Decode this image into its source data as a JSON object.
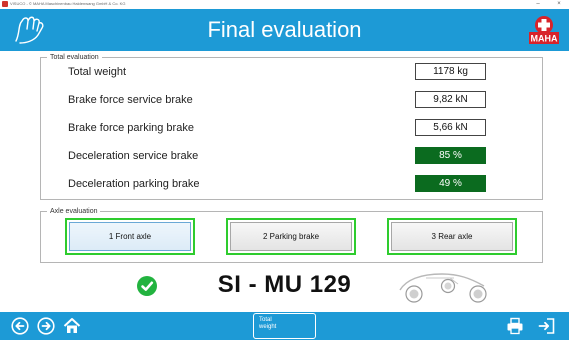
{
  "titlebar": {
    "title": "VISUCO - © MAHA Maschinenbau Haldenwang GmbH & Co. KG",
    "minimize": "–",
    "close": "×"
  },
  "header": {
    "title": "Final evaluation",
    "logo_text": "MAHA"
  },
  "total_evaluation": {
    "legend": "Total evaluation",
    "rows": [
      {
        "label": "Total weight",
        "value": "1178 kg",
        "highlight": false
      },
      {
        "label": "Brake force service brake",
        "value": "9,82 kN",
        "highlight": false
      },
      {
        "label": "Brake force parking brake",
        "value": "5,66 kN",
        "highlight": false
      },
      {
        "label": "Deceleration service brake",
        "value": "85 %",
        "highlight": true
      },
      {
        "label": "Deceleration parking brake",
        "value": "49 %",
        "highlight": true
      }
    ]
  },
  "axle_evaluation": {
    "legend": "Axle evaluation",
    "buttons": [
      {
        "label": "1 Front axle",
        "selected": true
      },
      {
        "label": "2 Parking brake",
        "selected": false
      },
      {
        "label": "3 Rear axle",
        "selected": false
      }
    ]
  },
  "status": {
    "plate": "SI - MU 129",
    "check_color": "#22b33f"
  },
  "footer": {
    "total_button": [
      "Total",
      "weight"
    ]
  },
  "colors": {
    "accent": "#1d9ad6",
    "ok_green": "#0b6b1f",
    "selection_border": "#2ecc2e"
  }
}
